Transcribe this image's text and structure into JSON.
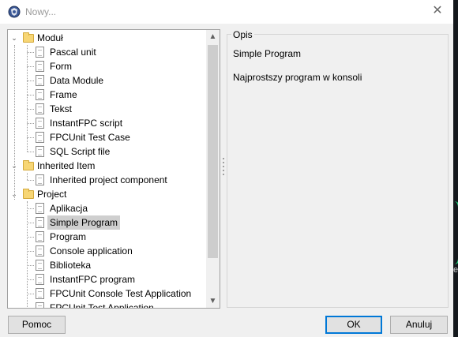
{
  "window": {
    "title": "Nowy..."
  },
  "tree": {
    "items": [
      {
        "label": "Moduł",
        "type": "folder",
        "level": 0,
        "expanded": true
      },
      {
        "label": "Pascal unit",
        "type": "item",
        "level": 1
      },
      {
        "label": "Form",
        "type": "item",
        "level": 1
      },
      {
        "label": "Data Module",
        "type": "item",
        "level": 1
      },
      {
        "label": "Frame",
        "type": "item",
        "level": 1
      },
      {
        "label": "Tekst",
        "type": "item",
        "level": 1
      },
      {
        "label": "InstantFPC script",
        "type": "item",
        "level": 1
      },
      {
        "label": "FPCUnit Test Case",
        "type": "item",
        "level": 1
      },
      {
        "label": "SQL Script file",
        "type": "item",
        "level": 1
      },
      {
        "label": "Inherited Item",
        "type": "folder",
        "level": 0,
        "expanded": true
      },
      {
        "label": "Inherited project component",
        "type": "item",
        "level": 1
      },
      {
        "label": "Project",
        "type": "folder",
        "level": 0,
        "expanded": true
      },
      {
        "label": "Aplikacja",
        "type": "item",
        "level": 1
      },
      {
        "label": "Simple Program",
        "type": "item",
        "level": 1,
        "selected": true
      },
      {
        "label": "Program",
        "type": "item",
        "level": 1
      },
      {
        "label": "Console application",
        "type": "item",
        "level": 1
      },
      {
        "label": "Biblioteka",
        "type": "item",
        "level": 1
      },
      {
        "label": "InstantFPC program",
        "type": "item",
        "level": 1
      },
      {
        "label": "FPCUnit Console Test Application",
        "type": "item",
        "level": 1
      },
      {
        "label": "FPCUnit Test Application",
        "type": "item",
        "level": 1
      }
    ]
  },
  "description": {
    "legend": "Opis",
    "name": "Simple Program",
    "text": "Najprostszy program w konsoli"
  },
  "buttons": {
    "help": "Pomoc",
    "ok": "OK",
    "cancel": "Anuluj"
  },
  "background": {
    "visible_text": "er"
  },
  "colors": {
    "selection": "#cfcfcf",
    "folder": "#f7d675",
    "accent": "#0078d7"
  }
}
